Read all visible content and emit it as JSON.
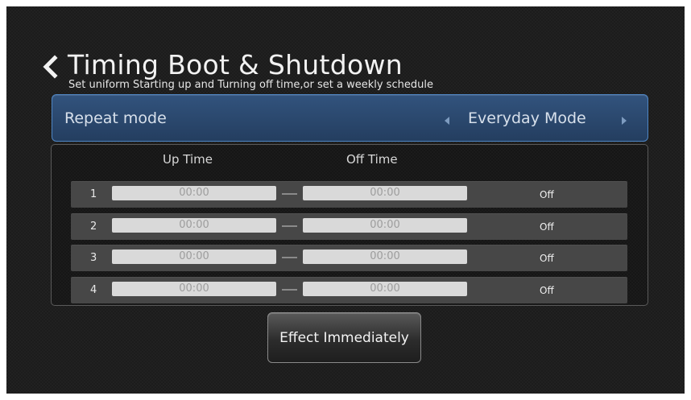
{
  "header": {
    "back_icon": "chevron-left-icon",
    "title": "Timing Boot & Shutdown",
    "subtitle": "Set uniform Starting up and Turning off time,or set a weekly schedule"
  },
  "repeat_mode": {
    "label": "Repeat mode",
    "value": "Everyday Mode",
    "prev_icon": "triangle-left-icon",
    "next_icon": "triangle-right-icon"
  },
  "schedule": {
    "columns": {
      "up_time": "Up Time",
      "off_time": "Off Time"
    },
    "rows": [
      {
        "num": "1",
        "up_time": "00:00",
        "off_time": "00:00",
        "status": "Off"
      },
      {
        "num": "2",
        "up_time": "00:00",
        "off_time": "00:00",
        "status": "Off"
      },
      {
        "num": "3",
        "up_time": "00:00",
        "off_time": "00:00",
        "status": "Off"
      },
      {
        "num": "4",
        "up_time": "00:00",
        "off_time": "00:00",
        "status": "Off"
      }
    ]
  },
  "actions": {
    "effect_label": "Effect Immediately"
  },
  "colors": {
    "background": "#1c1c1c",
    "repeat_bar": "#2b486d",
    "repeat_border": "#4f86c4",
    "row_background": "#474747",
    "time_field": "#d9d9d9"
  }
}
